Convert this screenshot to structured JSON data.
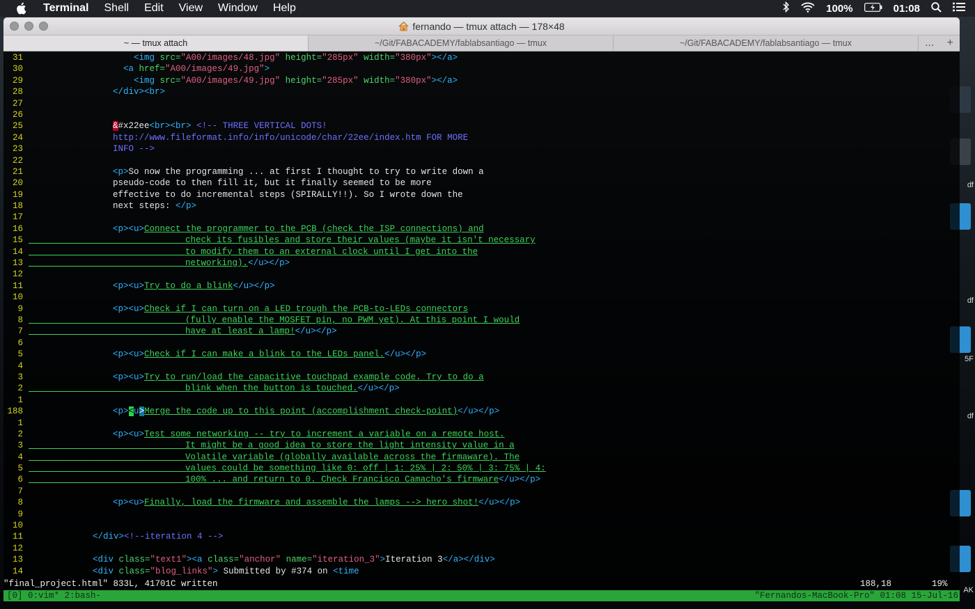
{
  "menubar": {
    "app": "Terminal",
    "items": [
      "Shell",
      "Edit",
      "View",
      "Window",
      "Help"
    ],
    "battery": "100%",
    "time": "01:08"
  },
  "window": {
    "title": "fernando — tmux attach — 178×48",
    "tabs": [
      {
        "label": "~ — tmux attach",
        "active": true
      },
      {
        "label": "~/Git/FABACADEMY/fablabsantiago — tmux",
        "active": false
      },
      {
        "label": "~/Git/FABACADEMY/fablabsantiago — tmux",
        "active": false
      }
    ],
    "tab_more": "...",
    "tab_add": "+"
  },
  "editor": {
    "lines": [
      {
        "n": "31",
        "code": [
          [
            "      ",
            "txt"
          ],
          [
            "<img ",
            "tag"
          ],
          [
            "src=",
            "attr"
          ],
          [
            "\"A00/images/48.jpg\"",
            "str"
          ],
          [
            " ",
            "txt"
          ],
          [
            "height=",
            "attr"
          ],
          [
            "\"285px\"",
            "str"
          ],
          [
            " ",
            "txt"
          ],
          [
            "width=",
            "attr"
          ],
          [
            "\"380px\"",
            "str"
          ],
          [
            "></a>",
            "tag"
          ]
        ]
      },
      {
        "n": "30",
        "code": [
          [
            "    ",
            "txt"
          ],
          [
            "<a ",
            "tag"
          ],
          [
            "href=",
            "attr"
          ],
          [
            "\"A00/images/49.jpg\"",
            "str"
          ],
          [
            ">",
            "tag"
          ]
        ]
      },
      {
        "n": "29",
        "code": [
          [
            "      ",
            "txt"
          ],
          [
            "<img ",
            "tag"
          ],
          [
            "src=",
            "attr"
          ],
          [
            "\"A00/images/49.jpg\"",
            "str"
          ],
          [
            " ",
            "txt"
          ],
          [
            "height=",
            "attr"
          ],
          [
            "\"285px\"",
            "str"
          ],
          [
            " ",
            "txt"
          ],
          [
            "width=",
            "attr"
          ],
          [
            "\"380px\"",
            "str"
          ],
          [
            "></a>",
            "tag"
          ]
        ]
      },
      {
        "n": "28",
        "code": [
          [
            "  ",
            "txt"
          ],
          [
            "</div><br>",
            "tag"
          ]
        ]
      },
      {
        "n": "27",
        "code": []
      },
      {
        "n": "26",
        "code": []
      },
      {
        "n": "25",
        "code": [
          [
            "  ",
            "txt"
          ],
          [
            "&",
            "red"
          ],
          [
            "#x22ee",
            "txt"
          ],
          [
            "<br><br>",
            "tag"
          ],
          [
            " <!-- THREE VERTICAL DOTS!",
            "cmt"
          ]
        ]
      },
      {
        "n": "24",
        "code": [
          [
            "  ",
            "txt"
          ],
          [
            "http://www.fileformat.info/info/unicode/char/22ee/index.htm FOR MORE",
            "cmt"
          ]
        ]
      },
      {
        "n": "23",
        "code": [
          [
            "  ",
            "txt"
          ],
          [
            "INFO -->",
            "cmt"
          ]
        ]
      },
      {
        "n": "22",
        "code": []
      },
      {
        "n": "21",
        "code": [
          [
            "  ",
            "txt"
          ],
          [
            "<p>",
            "tag"
          ],
          [
            "So now the programming ... at first I thought to try to write down a",
            "txt"
          ]
        ]
      },
      {
        "n": "20",
        "code": [
          [
            "  ",
            "txt"
          ],
          [
            "pseudo-code to then fill it, but it finally seemed to be more",
            "txt"
          ]
        ]
      },
      {
        "n": "19",
        "code": [
          [
            "  ",
            "txt"
          ],
          [
            "effective to do incremental steps (SPIRALLY!!). So I wrote down the",
            "txt"
          ]
        ]
      },
      {
        "n": "18",
        "code": [
          [
            "  ",
            "txt"
          ],
          [
            "next steps: ",
            "txt"
          ],
          [
            "</p>",
            "tag"
          ]
        ]
      },
      {
        "n": "17",
        "code": []
      },
      {
        "n": "16",
        "code": [
          [
            "  ",
            "txt"
          ],
          [
            "<p><u>",
            "tag"
          ],
          [
            "Connect the programmer to the PCB (check the ISP connections) and",
            "link"
          ]
        ]
      },
      {
        "n": "15",
        "code": [
          [
            "              ",
            "link"
          ],
          [
            "check its fusibles and store their values (maybe it isn't necessary",
            "link"
          ]
        ]
      },
      {
        "n": "14",
        "code": [
          [
            "              ",
            "link"
          ],
          [
            "to modify them to an external clock until I get into the",
            "link"
          ]
        ]
      },
      {
        "n": "13",
        "code": [
          [
            "              ",
            "link"
          ],
          [
            "networking).",
            "link"
          ],
          [
            "</u></p>",
            "tag"
          ]
        ]
      },
      {
        "n": "12",
        "code": []
      },
      {
        "n": "11",
        "code": [
          [
            "  ",
            "txt"
          ],
          [
            "<p><u>",
            "tag"
          ],
          [
            "Try to do a blink",
            "link"
          ],
          [
            "</u></p>",
            "tag"
          ]
        ]
      },
      {
        "n": "10",
        "code": []
      },
      {
        "n": "9",
        "code": [
          [
            "  ",
            "txt"
          ],
          [
            "<p><u>",
            "tag"
          ],
          [
            "Check if I can turn on a LED trough the PCB-to-LEDs connectors",
            "link"
          ]
        ]
      },
      {
        "n": "8",
        "code": [
          [
            "              ",
            "link"
          ],
          [
            "(fully enable the MOSFET pin, no PWM yet). At this point I would",
            "link"
          ]
        ]
      },
      {
        "n": "7",
        "code": [
          [
            "              ",
            "link"
          ],
          [
            "have at least a lamp!",
            "link"
          ],
          [
            "</u></p>",
            "tag"
          ]
        ]
      },
      {
        "n": "6",
        "code": []
      },
      {
        "n": "5",
        "code": [
          [
            "  ",
            "txt"
          ],
          [
            "<p><u>",
            "tag"
          ],
          [
            "Check if I can make a blink to the LEDs panel.",
            "link"
          ],
          [
            "</u></p>",
            "tag"
          ]
        ]
      },
      {
        "n": "4",
        "code": []
      },
      {
        "n": "3",
        "code": [
          [
            "  ",
            "txt"
          ],
          [
            "<p><u>",
            "tag"
          ],
          [
            "Try to run/load the capacitive touchpad example code. Try to do a",
            "link"
          ]
        ]
      },
      {
        "n": "2",
        "code": [
          [
            "              ",
            "link"
          ],
          [
            "blink when the button is touched.",
            "link"
          ],
          [
            "</u></p>",
            "tag"
          ]
        ]
      },
      {
        "n": "1",
        "code": []
      },
      {
        "n": "188",
        "code": [
          [
            "  ",
            "txt"
          ],
          [
            "<p>",
            "tag"
          ],
          [
            "<",
            "curs"
          ],
          [
            "u",
            "tag"
          ],
          [
            ">",
            "curs2"
          ],
          [
            "Merge the code up to this point (accomplishment check-point)",
            "link"
          ],
          [
            "</u></p>",
            "tag"
          ]
        ]
      },
      {
        "n": "1",
        "code": []
      },
      {
        "n": "2",
        "code": [
          [
            "  ",
            "txt"
          ],
          [
            "<p><u>",
            "tag"
          ],
          [
            "Test some networking -- try to increment a variable on a remote host.",
            "link"
          ]
        ]
      },
      {
        "n": "3",
        "code": [
          [
            "              ",
            "link"
          ],
          [
            "It might be a good idea to store the light intensity value in a",
            "link"
          ]
        ]
      },
      {
        "n": "4",
        "code": [
          [
            "              ",
            "link"
          ],
          [
            "Volatile variable (globally available across the firmaware). The",
            "link"
          ]
        ]
      },
      {
        "n": "5",
        "code": [
          [
            "              ",
            "link"
          ],
          [
            "values could be something like 0: off | 1: 25% | 2: 50% | 3: 75% | 4:",
            "link"
          ]
        ]
      },
      {
        "n": "6",
        "code": [
          [
            "              ",
            "link"
          ],
          [
            "100% ... and return to 0. Check Francisco Camacho's firmware",
            "link"
          ],
          [
            "</u></p>",
            "tag"
          ]
        ]
      },
      {
        "n": "7",
        "code": []
      },
      {
        "n": "8",
        "code": [
          [
            "  ",
            "txt"
          ],
          [
            "<p><u>",
            "tag"
          ],
          [
            "Finally, load the firmware and assemble the lamps --> hero shot!",
            "link"
          ],
          [
            "</u></p>",
            "tag"
          ]
        ]
      },
      {
        "n": "9",
        "code": []
      },
      {
        "n": "10",
        "code": []
      },
      {
        "n": "11",
        "code": [
          [
            "</div>",
            "tag"
          ],
          [
            "<!--iteration 4 -->",
            "cmt"
          ]
        ]
      },
      {
        "n": "12",
        "code": []
      },
      {
        "n": "13",
        "code": [
          [
            "<div ",
            "tag"
          ],
          [
            "class=",
            "attr"
          ],
          [
            "\"text1\"",
            "str"
          ],
          [
            "><a ",
            "tag"
          ],
          [
            "class=",
            "attr"
          ],
          [
            "\"anchor\"",
            "str"
          ],
          [
            " ",
            "txt"
          ],
          [
            "name=",
            "attr"
          ],
          [
            "\"iteration_3\"",
            "str"
          ],
          [
            ">",
            "tag"
          ],
          [
            "Iteration 3",
            "txt"
          ],
          [
            "</a></div>",
            "tag"
          ]
        ]
      },
      {
        "n": "14",
        "code": [
          [
            "<div ",
            "tag"
          ],
          [
            "class=",
            "attr"
          ],
          [
            "\"blog_links\"",
            "str"
          ],
          [
            ">",
            "tag"
          ],
          [
            " Submitted by #374 on ",
            "txt"
          ],
          [
            "<time",
            "tag"
          ]
        ]
      }
    ],
    "status_left": "\"final_project.html\" 833L, 41701C written",
    "status_pos": "188,18",
    "status_pct": "19%"
  },
  "tmux": {
    "left": "[0] 0:vim* 2:bash-",
    "right": "\"Fernandos-MacBook-Pro\" 01:08 15-Jul-16"
  },
  "desktop": {
    "labels": [
      "df",
      "df",
      "5F",
      "df",
      "AK"
    ]
  }
}
